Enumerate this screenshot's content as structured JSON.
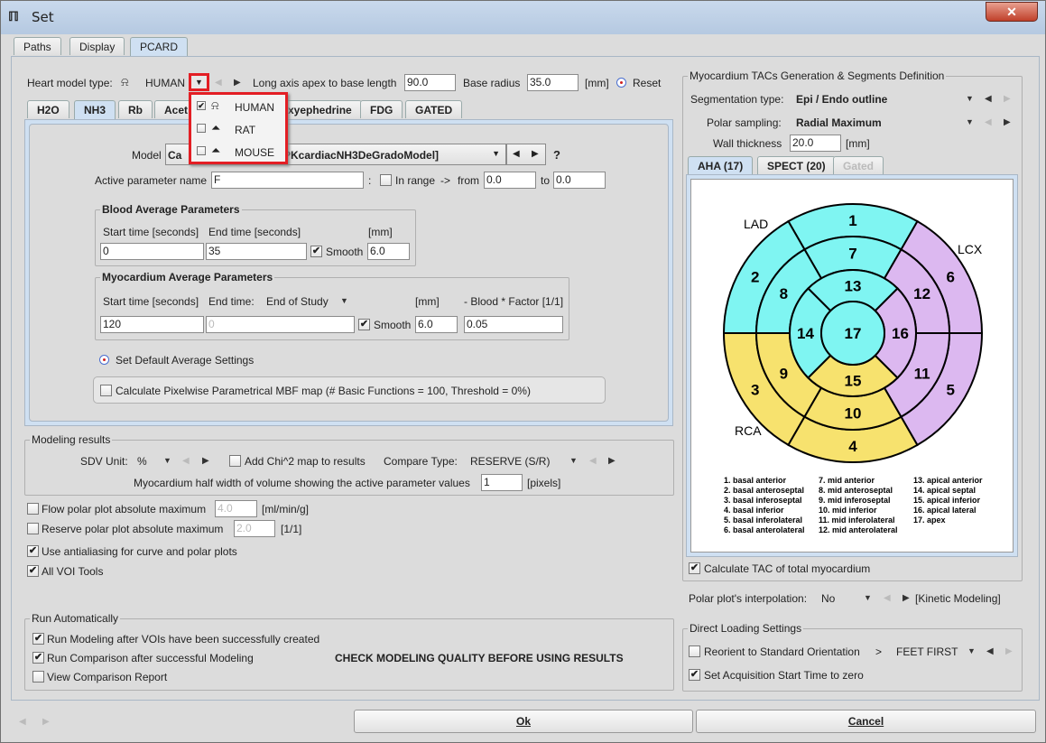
{
  "window": {
    "title": "Set",
    "close": "✕"
  },
  "top_tabs": [
    "Paths",
    "Display",
    "PCARD"
  ],
  "heart": {
    "label": "Heart model type:",
    "value": "HUMAN",
    "long_axis_label": "Long axis apex to base length",
    "long_axis": "90.0",
    "base_radius_label": "Base radius",
    "base_radius": "35.0",
    "unit": "[mm]",
    "reset": "Reset"
  },
  "heart_options": [
    {
      "label": "HUMAN",
      "checked": true
    },
    {
      "label": "RAT",
      "checked": false
    },
    {
      "label": "MOUSE",
      "checked": false
    }
  ],
  "tracer_tabs": [
    "H2O",
    "NH3",
    "Rb",
    "Acet",
    "xyephedrine",
    "FDG",
    "GATED"
  ],
  "model": {
    "label": "Model",
    "value_start": "Ca",
    "value_end": "PKcardiacNH3DeGradoModel]",
    "help": "?",
    "param_label": "Active parameter name",
    "param": "F",
    "colon": ":",
    "in_range": "In range",
    "arrow": "->",
    "from_label": "from",
    "from": "0.0",
    "to_label": "to",
    "to": "0.0"
  },
  "blood": {
    "title": "Blood Average Parameters",
    "start_label": "Start time [seconds]",
    "end_label": "End time [seconds]",
    "mm": "[mm]",
    "start": "0",
    "end": "35",
    "smooth": "Smooth",
    "smooth_val": "6.0"
  },
  "myo": {
    "title": "Myocardium Average Parameters",
    "start_label": "Start time [seconds]",
    "end_label": "End time:",
    "end_mode": "End of Study",
    "mm": "[mm]",
    "factor_label": "- Blood * Factor [1/1]",
    "start": "120",
    "end": "0",
    "smooth": "Smooth",
    "smooth_val": "6.0",
    "factor": "0.05"
  },
  "default_avg": "Set Default Average Settings",
  "pixelwise": "Calculate Pixelwise Parametrical MBF map (# Basic Functions = 100, Threshold = 0%)",
  "modeling": {
    "title": "Modeling results",
    "sdv_label": "SDV Unit:",
    "sdv": "%",
    "chi": "Add Chi^2 map to results",
    "compare_label": "Compare Type:",
    "compare": "RESERVE (S/R)",
    "half_width_label": "Myocardium half width of volume showing the active parameter values",
    "half_width": "1",
    "pixels": "[pixels]"
  },
  "flow_max": {
    "label": "Flow polar plot absolute maximum",
    "value": "4.0",
    "unit": "[ml/min/g]"
  },
  "reserve_max": {
    "label": "Reserve polar plot absolute maximum",
    "value": "2.0",
    "unit": "[1/1]"
  },
  "antialias": "Use antialiasing for curve and polar plots",
  "all_voi": "All VOI Tools",
  "run": {
    "title": "Run Automatically",
    "items": [
      "Run Modeling after VOIs have been successfully created",
      "Run Comparison after successful Modeling",
      "View Comparison Report"
    ],
    "checked": [
      true,
      true,
      false
    ],
    "warning": "CHECK MODELING QUALITY BEFORE USING RESULTS"
  },
  "tacs": {
    "title": "Myocardium TACs Generation & Segments Definition",
    "seg_label": "Segmentation type:",
    "seg": "Epi / Endo outline",
    "polar_label": "Polar sampling:",
    "polar": "Radial Maximum",
    "wall_label": "Wall thickness",
    "wall": "20.0",
    "mm": "[mm]",
    "tabs": [
      "AHA (17)",
      "SPECT (20)",
      "Gated"
    ],
    "calc_total": "Calculate TAC of total myocardium"
  },
  "polar_plot": {
    "colors": {
      "LAD": "#7ff5f2",
      "LCX": "#dcb8f0",
      "RCA": "#f7e26e"
    },
    "territories": [
      "LAD",
      "LCX",
      "RCA"
    ],
    "basal": [
      {
        "n": "1",
        "t": "LAD"
      },
      {
        "n": "2",
        "t": "LAD"
      },
      {
        "n": "3",
        "t": "RCA"
      },
      {
        "n": "4",
        "t": "RCA"
      },
      {
        "n": "5",
        "t": "LCX"
      },
      {
        "n": "6",
        "t": "LCX"
      }
    ],
    "mid": [
      {
        "n": "7",
        "t": "LAD"
      },
      {
        "n": "8",
        "t": "LAD"
      },
      {
        "n": "9",
        "t": "RCA"
      },
      {
        "n": "10",
        "t": "RCA"
      },
      {
        "n": "11",
        "t": "LCX"
      },
      {
        "n": "12",
        "t": "LCX"
      }
    ],
    "apical": [
      {
        "n": "13",
        "t": "LAD"
      },
      {
        "n": "14",
        "t": "LAD"
      },
      {
        "n": "15",
        "t": "RCA"
      },
      {
        "n": "16",
        "t": "LCX"
      }
    ],
    "apex": {
      "n": "17",
      "t": "LAD"
    },
    "legend": [
      [
        "1. basal anterior",
        "2. basal anteroseptal",
        "3. basal inferoseptal",
        "4. basal inferior",
        "5. basal inferolateral",
        "6. basal anterolateral"
      ],
      [
        "7. mid anterior",
        "8. mid anteroseptal",
        "9. mid inferoseptal",
        "10. mid inferior",
        "11. mid inferolateral",
        "12. mid anterolateral"
      ],
      [
        "13. apical anterior",
        "14. apical septal",
        "15. apical inferior",
        "16. apical lateral",
        "17. apex"
      ]
    ]
  },
  "interp": {
    "label": "Polar plot's interpolation:",
    "value": "No",
    "kinetic": "[Kinetic Modeling]"
  },
  "direct": {
    "title": "Direct Loading Settings",
    "reorient": "Reorient to Standard Orientation",
    "gt": ">",
    "orientation": "FEET FIRST",
    "acq": "Set Acquisition Start Time to zero"
  },
  "buttons": {
    "ok": "Ok",
    "cancel": "Cancel"
  }
}
